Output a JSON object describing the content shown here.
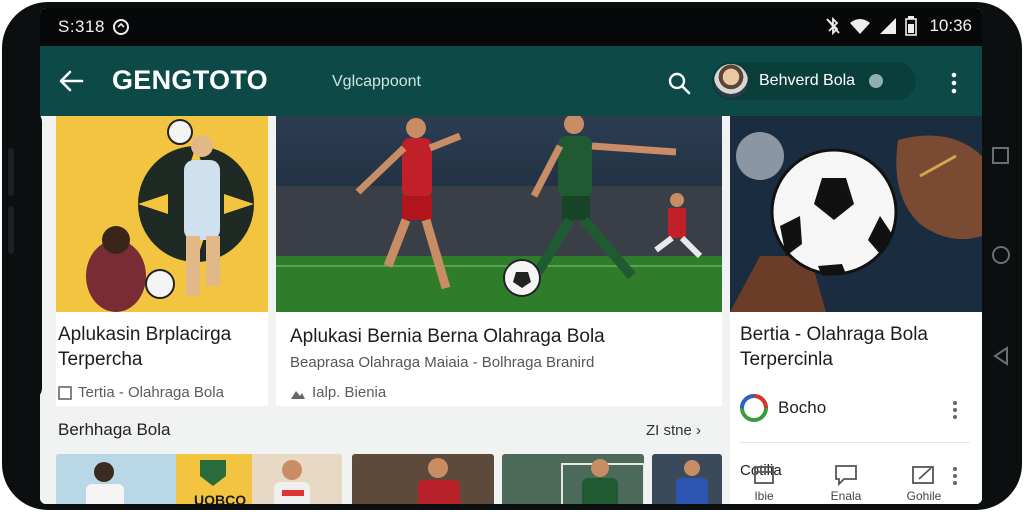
{
  "status": {
    "left_time": "S:318",
    "right_time": "10:36"
  },
  "appbar": {
    "title": "GENGTOTO",
    "subtitle": "Vglcappoont",
    "account_name": "Behverd Bola"
  },
  "cards": [
    {
      "title_line1": "Aplukasin Brplacirga",
      "title_line2": "Terpercha",
      "meta": "Tertia - Olahraga Bola"
    },
    {
      "title": "Aplukasi Bernia Berna Olahraga Bola",
      "subtitle": "Beaprasa Olahraga Maiaia - Bolhraga Branird",
      "meta": "Ialp. Bienia"
    },
    {
      "title_line1": "Bertia - Olahraga Bola",
      "title_line2": "Terpercinla"
    }
  ],
  "section": {
    "title": "Berhhaga Bola",
    "see_all": "ZI stne"
  },
  "thumbs": [
    {
      "label": "UOBCO"
    },
    {
      "label": ""
    },
    {
      "label": ""
    },
    {
      "label": ""
    },
    {
      "label": ""
    }
  ],
  "right_panel": {
    "author": "Bocho",
    "section_label": "Cotilia",
    "actions": [
      {
        "label": "Ibie",
        "icon": "window-icon"
      },
      {
        "label": "Enala",
        "icon": "comment-icon"
      },
      {
        "label": "Gohile",
        "icon": "share-icon"
      }
    ]
  },
  "colors": {
    "appbar": "#0d4a47",
    "statusbar": "#070809",
    "pitch": "#2f7d2b",
    "card_yellow": "#f2c440"
  }
}
